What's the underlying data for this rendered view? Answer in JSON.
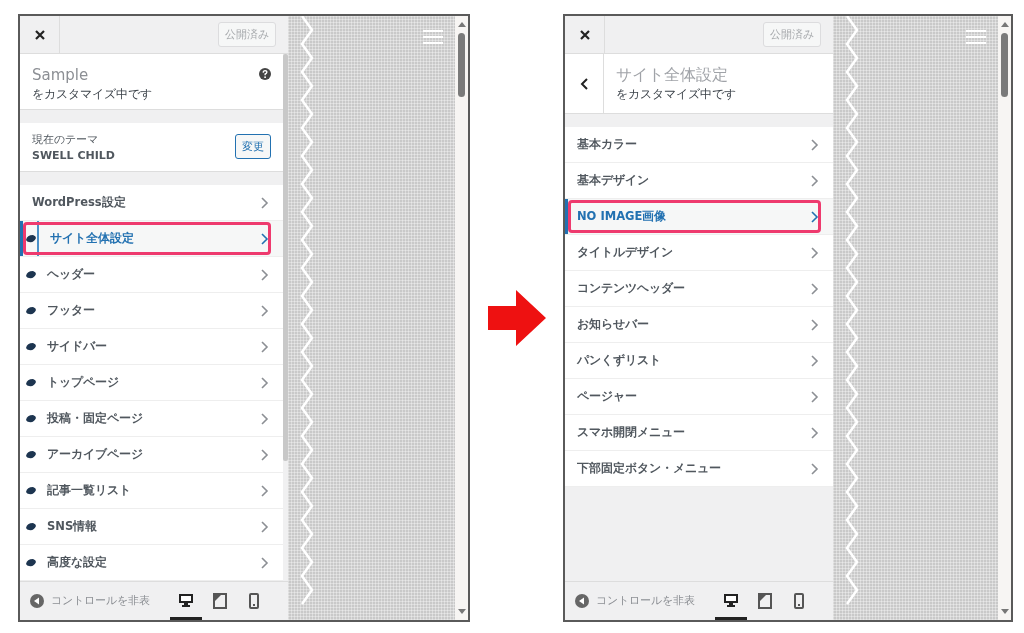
{
  "panels": [
    {
      "header": {
        "publish_button": "公開済み"
      },
      "scrollable": true,
      "info": {
        "kind": "site",
        "title": "Sample",
        "subtitle": "をカスタマイズ中です"
      },
      "theme": {
        "label": "現在のテーマ",
        "name": "SWELL CHILD",
        "button": "変更"
      },
      "items": [
        {
          "label": "WordPress設定",
          "icon": false,
          "selected": false,
          "highlighted": false
        },
        {
          "label": "サイト全体設定",
          "icon": true,
          "selected": true,
          "highlighted": true
        },
        {
          "label": "ヘッダー",
          "icon": true,
          "selected": false,
          "highlighted": false
        },
        {
          "label": "フッター",
          "icon": true,
          "selected": false,
          "highlighted": false
        },
        {
          "label": "サイドバー",
          "icon": true,
          "selected": false,
          "highlighted": false
        },
        {
          "label": "トップページ",
          "icon": true,
          "selected": false,
          "highlighted": false
        },
        {
          "label": "投稿・固定ページ",
          "icon": true,
          "selected": false,
          "highlighted": false
        },
        {
          "label": "アーカイブページ",
          "icon": true,
          "selected": false,
          "highlighted": false
        },
        {
          "label": "記事一覧リスト",
          "icon": true,
          "selected": false,
          "highlighted": false
        },
        {
          "label": "SNS情報",
          "icon": true,
          "selected": false,
          "highlighted": false
        },
        {
          "label": "高度な設定",
          "icon": true,
          "selected": false,
          "highlighted": false
        }
      ],
      "footer": {
        "hide_label": "コントロールを非表",
        "devices": [
          {
            "kind": "desktop",
            "selected": true
          },
          {
            "kind": "tablet",
            "selected": false
          },
          {
            "kind": "mobile",
            "selected": false
          }
        ]
      }
    },
    {
      "header": {
        "publish_button": "公開済み"
      },
      "scrollable": false,
      "info": {
        "kind": "section",
        "title": "サイト全体設定",
        "subtitle": "をカスタマイズ中です"
      },
      "items": [
        {
          "label": "基本カラー",
          "icon": false,
          "selected": false,
          "highlighted": false
        },
        {
          "label": "基本デザイン",
          "icon": false,
          "selected": false,
          "highlighted": false
        },
        {
          "label": "NO IMAGE画像",
          "icon": false,
          "selected": true,
          "highlighted": true
        },
        {
          "label": "タイトルデザイン",
          "icon": false,
          "selected": false,
          "highlighted": false
        },
        {
          "label": "コンテンツヘッダー",
          "icon": false,
          "selected": false,
          "highlighted": false
        },
        {
          "label": "お知らせバー",
          "icon": false,
          "selected": false,
          "highlighted": false
        },
        {
          "label": "パンくずリスト",
          "icon": false,
          "selected": false,
          "highlighted": false
        },
        {
          "label": "ページャー",
          "icon": false,
          "selected": false,
          "highlighted": false
        },
        {
          "label": "スマホ開閉メニュー",
          "icon": false,
          "selected": false,
          "highlighted": false
        },
        {
          "label": "下部固定ボタン・メニュー",
          "icon": false,
          "selected": false,
          "highlighted": false
        }
      ],
      "footer": {
        "hide_label": "コントロールを非表",
        "devices": [
          {
            "kind": "desktop",
            "selected": true
          },
          {
            "kind": "tablet",
            "selected": false
          },
          {
            "kind": "mobile",
            "selected": false
          }
        ]
      }
    }
  ]
}
